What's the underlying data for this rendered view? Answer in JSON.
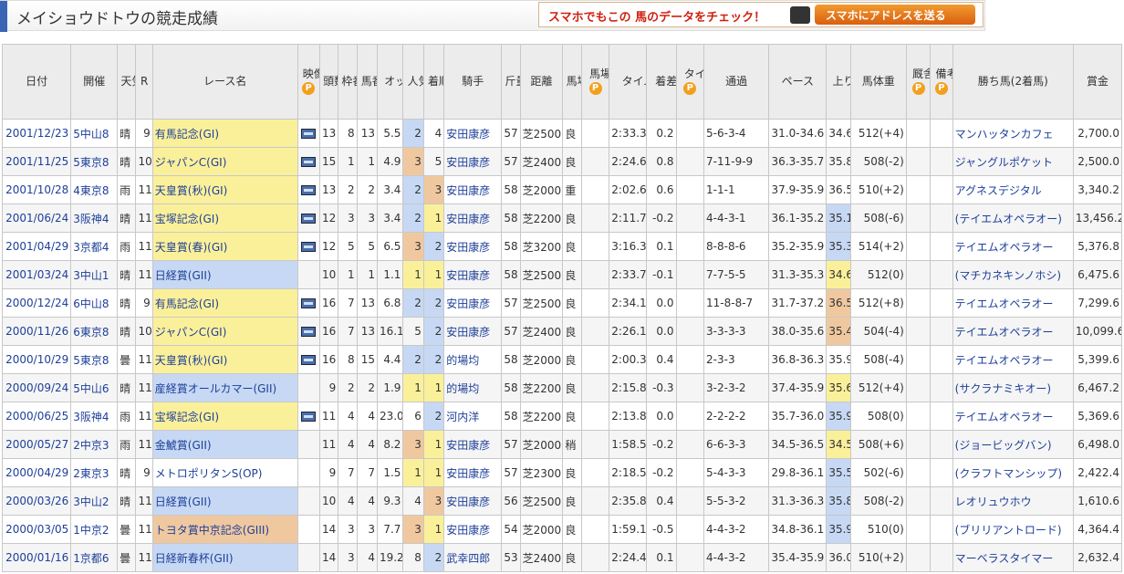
{
  "page": {
    "title": "メイショウドトウの競走成績"
  },
  "smartphone_banner": {
    "text": "スマホでもこの 馬のデータをチェック！",
    "button": "スマホにアドレスを送る"
  },
  "table": {
    "headers": [
      "日付",
      "開催",
      "天気",
      "R",
      "レース名",
      "映像",
      "頭数",
      "枠番",
      "馬番",
      "オッズ",
      "人気",
      "着順",
      "騎手",
      "斤量",
      "距離",
      "馬場",
      "馬場指数",
      "タイム",
      "着差",
      "タイム指数",
      "通過",
      "ペース",
      "上り",
      "馬体重",
      "厩舎コメント",
      "備考",
      "勝ち馬(2着馬)",
      "賞金"
    ],
    "premium_mark": "P",
    "rows": [
      {
        "date": "2001/12/23",
        "venue": "5中山8",
        "weather": "晴",
        "r": "9",
        "race": "有馬記念(GI)",
        "grade": "1",
        "video": true,
        "heads": "13",
        "waku": "8",
        "uma": "13",
        "odds": "5.5",
        "pop": "2",
        "finish": "4",
        "jockey": "安田康彦",
        "kinryo": "57",
        "dist": "芝2500",
        "baba": "良",
        "time": "2:33.3",
        "diff": "0.2",
        "pass": "5-6-3-4",
        "pace": "31.0-34.6",
        "agari": "34.6",
        "agari_rank": "",
        "weight": "512(+4)",
        "winner": "マンハッタンカフェ",
        "prize": "2,700.0"
      },
      {
        "date": "2001/11/25",
        "venue": "5東京8",
        "weather": "晴",
        "r": "10",
        "race": "ジャパンC(GI)",
        "grade": "1",
        "video": true,
        "heads": "15",
        "waku": "1",
        "uma": "1",
        "odds": "4.9",
        "pop": "3",
        "finish": "5",
        "jockey": "安田康彦",
        "kinryo": "57",
        "dist": "芝2400",
        "baba": "良",
        "time": "2:24.6",
        "diff": "0.8",
        "pass": "7-11-9-9",
        "pace": "36.3-35.7",
        "agari": "35.8",
        "agari_rank": "",
        "weight": "508(-2)",
        "winner": "ジャングルポケット",
        "prize": "2,500.0"
      },
      {
        "date": "2001/10/28",
        "venue": "4東京8",
        "weather": "雨",
        "r": "11",
        "race": "天皇賞(秋)(GI)",
        "grade": "1",
        "video": true,
        "heads": "13",
        "waku": "2",
        "uma": "2",
        "odds": "3.4",
        "pop": "2",
        "finish": "3",
        "jockey": "安田康彦",
        "kinryo": "58",
        "dist": "芝2000",
        "baba": "重",
        "time": "2:02.6",
        "diff": "0.6",
        "pass": "1-1-1",
        "pace": "37.9-35.9",
        "agari": "36.5",
        "agari_rank": "",
        "weight": "510(+2)",
        "winner": "アグネスデジタル",
        "prize": "3,340.2"
      },
      {
        "date": "2001/06/24",
        "venue": "3阪神4",
        "weather": "晴",
        "r": "11",
        "race": "宝塚記念(GI)",
        "grade": "1",
        "video": true,
        "heads": "12",
        "waku": "3",
        "uma": "3",
        "odds": "3.4",
        "pop": "2",
        "finish": "1",
        "jockey": "安田康彦",
        "kinryo": "58",
        "dist": "芝2200",
        "baba": "良",
        "time": "2:11.7",
        "diff": "-0.2",
        "pass": "4-4-3-1",
        "pace": "36.1-35.2",
        "agari": "35.1",
        "agari_rank": "2",
        "weight": "508(-6)",
        "winner": "(テイエムオペラオー)",
        "prize": "13,456.2"
      },
      {
        "date": "2001/04/29",
        "venue": "3京都4",
        "weather": "雨",
        "r": "11",
        "race": "天皇賞(春)(GI)",
        "grade": "1",
        "video": true,
        "heads": "12",
        "waku": "5",
        "uma": "5",
        "odds": "6.5",
        "pop": "3",
        "finish": "2",
        "jockey": "安田康彦",
        "kinryo": "58",
        "dist": "芝3200",
        "baba": "良",
        "time": "3:16.3",
        "diff": "0.1",
        "pass": "8-8-8-6",
        "pace": "35.2-35.9",
        "agari": "35.3",
        "agari_rank": "2",
        "weight": "514(+2)",
        "winner": "テイエムオペラオー",
        "prize": "5,376.8"
      },
      {
        "date": "2001/03/24",
        "venue": "3中山1",
        "weather": "晴",
        "r": "11",
        "race": "日経賞(GII)",
        "grade": "2",
        "video": false,
        "heads": "10",
        "waku": "1",
        "uma": "1",
        "odds": "1.1",
        "pop": "1",
        "finish": "1",
        "jockey": "安田康彦",
        "kinryo": "58",
        "dist": "芝2500",
        "baba": "良",
        "time": "2:33.7",
        "diff": "-0.1",
        "pass": "7-7-5-5",
        "pace": "31.3-35.3",
        "agari": "34.6",
        "agari_rank": "1",
        "weight": "512(0)",
        "winner": "(マチカネキンノホシ)",
        "prize": "6,475.6"
      },
      {
        "date": "2000/12/24",
        "venue": "6中山8",
        "weather": "晴",
        "r": "9",
        "race": "有馬記念(GI)",
        "grade": "1",
        "video": true,
        "heads": "16",
        "waku": "7",
        "uma": "13",
        "odds": "6.8",
        "pop": "2",
        "finish": "2",
        "jockey": "安田康彦",
        "kinryo": "57",
        "dist": "芝2500",
        "baba": "良",
        "time": "2:34.1",
        "diff": "0.0",
        "pass": "11-8-8-7",
        "pace": "31.7-37.2",
        "agari": "36.5",
        "agari_rank": "3",
        "weight": "512(+8)",
        "winner": "テイエムオペラオー",
        "prize": "7,299.6"
      },
      {
        "date": "2000/11/26",
        "venue": "6東京8",
        "weather": "晴",
        "r": "10",
        "race": "ジャパンC(GI)",
        "grade": "1",
        "video": true,
        "heads": "16",
        "waku": "7",
        "uma": "13",
        "odds": "16.1",
        "pop": "5",
        "finish": "2",
        "jockey": "安田康彦",
        "kinryo": "57",
        "dist": "芝2400",
        "baba": "良",
        "time": "2:26.1",
        "diff": "0.0",
        "pass": "3-3-3-3",
        "pace": "38.0-35.6",
        "agari": "35.4",
        "agari_rank": "3",
        "weight": "504(-4)",
        "winner": "テイエムオペラオー",
        "prize": "10,099.6"
      },
      {
        "date": "2000/10/29",
        "venue": "5東京8",
        "weather": "曇",
        "r": "11",
        "race": "天皇賞(秋)(GI)",
        "grade": "1",
        "video": true,
        "heads": "16",
        "waku": "8",
        "uma": "15",
        "odds": "4.4",
        "pop": "2",
        "finish": "2",
        "jockey": "的場均",
        "kinryo": "58",
        "dist": "芝2000",
        "baba": "良",
        "time": "2:00.3",
        "diff": "0.4",
        "pass": "2-3-3",
        "pace": "36.8-36.3",
        "agari": "35.9",
        "agari_rank": "",
        "weight": "508(-4)",
        "winner": "テイエムオペラオー",
        "prize": "5,399.6"
      },
      {
        "date": "2000/09/24",
        "venue": "5中山6",
        "weather": "晴",
        "r": "11",
        "race": "産経賞オールカマー(GII)",
        "grade": "2",
        "video": false,
        "heads": "9",
        "waku": "2",
        "uma": "2",
        "odds": "1.9",
        "pop": "1",
        "finish": "1",
        "jockey": "的場均",
        "kinryo": "58",
        "dist": "芝2200",
        "baba": "良",
        "time": "2:15.8",
        "diff": "-0.3",
        "pass": "3-2-3-2",
        "pace": "37.4-35.9",
        "agari": "35.6",
        "agari_rank": "1",
        "weight": "512(+4)",
        "winner": "(サクラナミキオー)",
        "prize": "6,467.2"
      },
      {
        "date": "2000/06/25",
        "venue": "3阪神4",
        "weather": "雨",
        "r": "11",
        "race": "宝塚記念(GI)",
        "grade": "1",
        "video": true,
        "heads": "11",
        "waku": "4",
        "uma": "4",
        "odds": "23.0",
        "pop": "6",
        "finish": "2",
        "jockey": "河内洋",
        "kinryo": "58",
        "dist": "芝2200",
        "baba": "良",
        "time": "2:13.8",
        "diff": "0.0",
        "pass": "2-2-2-2",
        "pace": "35.7-36.0",
        "agari": "35.9",
        "agari_rank": "2",
        "weight": "508(0)",
        "winner": "テイエムオペラオー",
        "prize": "5,369.6"
      },
      {
        "date": "2000/05/27",
        "venue": "2中京3",
        "weather": "雨",
        "r": "11",
        "race": "金鯱賞(GII)",
        "grade": "2",
        "video": false,
        "heads": "11",
        "waku": "4",
        "uma": "4",
        "odds": "8.2",
        "pop": "3",
        "finish": "1",
        "jockey": "安田康彦",
        "kinryo": "57",
        "dist": "芝2000",
        "baba": "稍",
        "time": "1:58.5",
        "diff": "-0.2",
        "pass": "6-6-3-3",
        "pace": "34.5-36.5",
        "agari": "34.5",
        "agari_rank": "1",
        "weight": "508(+6)",
        "winner": "(ジョービッグバン)",
        "prize": "6,498.0"
      },
      {
        "date": "2000/04/29",
        "venue": "2東京3",
        "weather": "晴",
        "r": "9",
        "race": "メトロポリタンS(OP)",
        "grade": "",
        "video": false,
        "heads": "9",
        "waku": "7",
        "uma": "7",
        "odds": "1.5",
        "pop": "1",
        "finish": "1",
        "jockey": "安田康彦",
        "kinryo": "57",
        "dist": "芝2300",
        "baba": "良",
        "time": "2:18.5",
        "diff": "-0.2",
        "pass": "5-4-3-3",
        "pace": "29.8-36.1",
        "agari": "35.5",
        "agari_rank": "2",
        "weight": "502(-6)",
        "winner": "(クラフトマンシップ)",
        "prize": "2,422.4"
      },
      {
        "date": "2000/03/26",
        "venue": "3中山2",
        "weather": "晴",
        "r": "11",
        "race": "日経賞(GII)",
        "grade": "2",
        "video": false,
        "heads": "10",
        "waku": "4",
        "uma": "4",
        "odds": "9.3",
        "pop": "4",
        "finish": "3",
        "jockey": "安田康彦",
        "kinryo": "56",
        "dist": "芝2500",
        "baba": "良",
        "time": "2:35.8",
        "diff": "0.4",
        "pass": "5-5-3-2",
        "pace": "31.3-36.3",
        "agari": "35.8",
        "agari_rank": "2",
        "weight": "508(-2)",
        "winner": "レオリュウホウ",
        "prize": "1,610.6"
      },
      {
        "date": "2000/03/05",
        "venue": "1中京2",
        "weather": "曇",
        "r": "11",
        "race": "トヨタ賞中京記念(GIII)",
        "grade": "3",
        "video": false,
        "heads": "14",
        "waku": "3",
        "uma": "3",
        "odds": "7.7",
        "pop": "3",
        "finish": "1",
        "jockey": "安田康彦",
        "kinryo": "54",
        "dist": "芝2000",
        "baba": "良",
        "time": "1:59.1",
        "diff": "-0.5",
        "pass": "4-4-3-2",
        "pace": "34.8-36.1",
        "agari": "35.9",
        "agari_rank": "2",
        "weight": "510(0)",
        "winner": "(ブリリアントロード)",
        "prize": "4,364.4"
      },
      {
        "date": "2000/01/16",
        "venue": "1京都6",
        "weather": "曇",
        "r": "11",
        "race": "日経新春杯(GII)",
        "grade": "2",
        "video": false,
        "heads": "14",
        "waku": "3",
        "uma": "4",
        "odds": "19.2",
        "pop": "8",
        "finish": "2",
        "jockey": "武幸四郎",
        "kinryo": "53",
        "dist": "芝2400",
        "baba": "良",
        "time": "2:24.4",
        "diff": "0.1",
        "pass": "4-4-3-2",
        "pace": "35.4-35.9",
        "agari": "36.0",
        "agari_rank": "",
        "weight": "510(+2)",
        "winner": "マーベラスタイマー",
        "prize": "2,632.4"
      }
    ]
  }
}
